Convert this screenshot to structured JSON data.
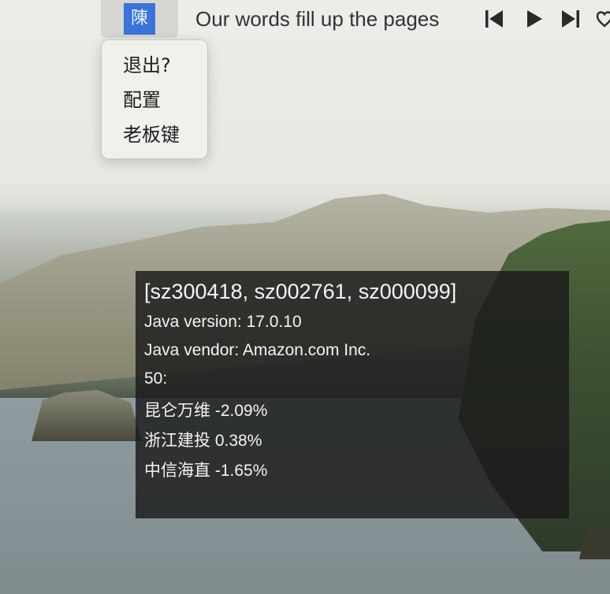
{
  "menubar": {
    "app_icon_glyph": "陳",
    "now_playing": "Our words fill up the pages",
    "controls": [
      {
        "icon": "previous-track-icon"
      },
      {
        "icon": "play-icon"
      },
      {
        "icon": "next-track-icon"
      },
      {
        "icon": "heart-icon"
      }
    ]
  },
  "dropdown": {
    "items": [
      {
        "label": "退出?"
      },
      {
        "label": "配置"
      },
      {
        "label": "老板键"
      }
    ]
  },
  "overlay": {
    "title": "[sz300418, sz002761, sz000099]",
    "java_version": "Java version: 17.0.10",
    "java_vendor": "Java vendor: Amazon.com Inc.",
    "header": "50:",
    "stocks": [
      {
        "text": "昆仑万维 -2.09%"
      },
      {
        "text": "浙江建投 0.38%"
      },
      {
        "text": "中信海直 -1.65%"
      }
    ]
  },
  "colors": {
    "app_icon_bg": "#3a74d9",
    "overlay_bg": "#1a1a1a",
    "menu_bg": "#f0f0ec"
  }
}
